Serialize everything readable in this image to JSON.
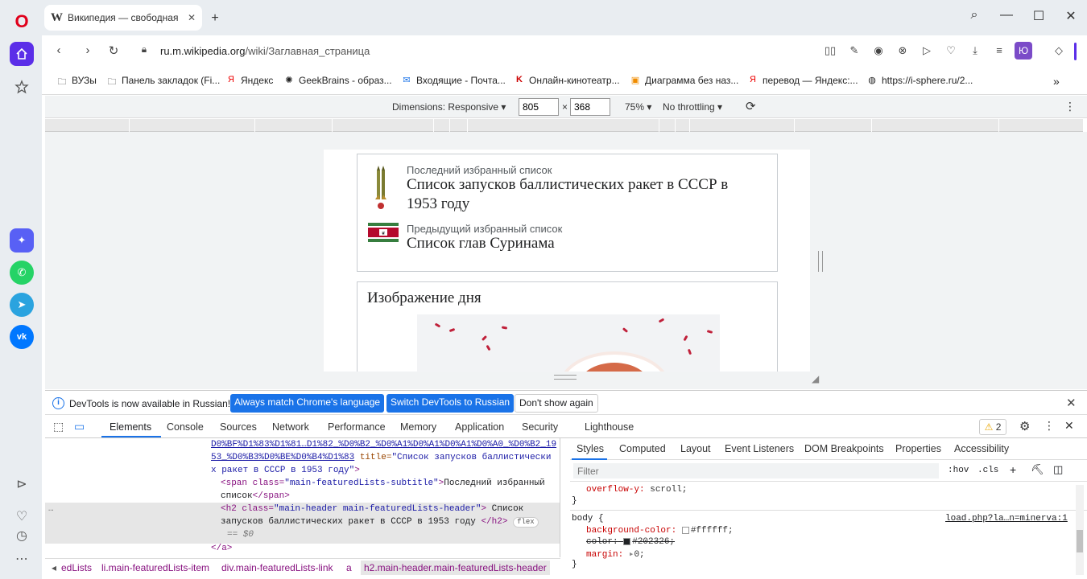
{
  "browser": {
    "tab_title": "Википедия — свободная",
    "url_host": "ru.m.wikipedia.org",
    "url_path": "/wiki/Заглавная_страница",
    "profile_initial": "Ю"
  },
  "sidebar": {
    "apps": [
      {
        "name": "apps-app",
        "color": "#5860f5",
        "glyph": "✦"
      },
      {
        "name": "whatsapp",
        "color": "#25d366",
        "glyph": "✆"
      },
      {
        "name": "telegram",
        "color": "#2aa3df",
        "glyph": "➤"
      },
      {
        "name": "vk",
        "color": "#0077ff",
        "glyph": "vk"
      }
    ]
  },
  "bookmarks": [
    {
      "label": "ВУЗы",
      "icon": "folder-icon"
    },
    {
      "label": "Панель закладок (Fi...",
      "icon": "folder-icon"
    },
    {
      "label": "Яндекс",
      "icon": "yandex-icon"
    },
    {
      "label": "GeekBrains - образ...",
      "icon": "geekbrains-icon"
    },
    {
      "label": "Входящие - Почта...",
      "icon": "mail-icon"
    },
    {
      "label": "Онлайн-кинотеатр...",
      "icon": "kinopoisk-icon"
    },
    {
      "label": "Диаграмма без наз...",
      "icon": "diagram-icon"
    },
    {
      "label": "перевод — Яндекс:...",
      "icon": "yandex-icon"
    },
    {
      "label": "https://i-sphere.ru/2...",
      "icon": "globe-icon"
    }
  ],
  "device_toolbar": {
    "dimensions_label": "Dimensions: Responsive",
    "width": "805",
    "height": "368",
    "times": "×",
    "zoom": "75%",
    "throttling": "No throttling"
  },
  "page": {
    "latest_sub": "Последний избранный список",
    "latest_title": "Список запусков баллистических ракет в СССР в 1953 году",
    "prev_sub": "Предыдущий избранный список",
    "prev_title": "Список глав Суринама",
    "potd_title": "Изображение дня"
  },
  "infobar": {
    "text": "DevTools is now available in Russian!",
    "btn_match": "Always match Chrome's language",
    "btn_switch": "Switch DevTools to Russian",
    "btn_dont": "Don't show again"
  },
  "devtools": {
    "tabs": [
      "Elements",
      "Console",
      "Sources",
      "Network",
      "Performance",
      "Memory",
      "Application",
      "Security",
      "Lighthouse"
    ],
    "warnings": "2",
    "elements": {
      "l1": "D0%BF%D1%83%D1%81…D1%82_%D0%B2_%D0%A1%D0%A1%D0%A1%D0%A0_%D0%B2_19",
      "l2": "53_%D0%B3%D0%BE%D0%B4%D1%83",
      "l2_attr": " title=",
      "l2_val": "\"Список запусков баллистически",
      "l3_val": "х ракет в СССР в 1953 году\"",
      "l4_tag": "<span class=",
      "l4_val": "\"main-featuredLists-subtitle\"",
      "l4_text": "Последний избранный",
      "l5_text": "список",
      "l5_close": "</span>",
      "l6_tag": "<h2 class=",
      "l6_val": "\"main-header main-featuredLists-header\"",
      "l6_text": " Список",
      "l7_text": "запусков баллистических ракет в СССР в 1953 году ",
      "l7_close": "</h2>",
      "flex": "flex",
      "l8": "== $0",
      "l9": "</a>",
      "dots": "…"
    },
    "breadcrumbs": [
      "edLists",
      "li.main-featuredLists-item",
      "div.main-featuredLists-link",
      "a",
      "h2.main-header.main-featuredLists-header"
    ],
    "styles_tabs": [
      "Styles",
      "Computed",
      "Layout",
      "Event Listeners",
      "DOM Breakpoints",
      "Properties",
      "Accessibility"
    ],
    "filter_placeholder": "Filter",
    "hov": ":hov",
    "cls": ".cls",
    "rules": {
      "overflow": "overflow-y:",
      "overflow_val": " scroll;",
      "close1": "}",
      "selector": "body {",
      "source": "load.php?la…n=minerva:1",
      "bg": "background-color:",
      "bg_val": "#ffffff;",
      "color": "color:",
      "color_val": "#202326;",
      "margin": "margin:",
      "margin_val": "0;",
      "close2": "}"
    }
  }
}
